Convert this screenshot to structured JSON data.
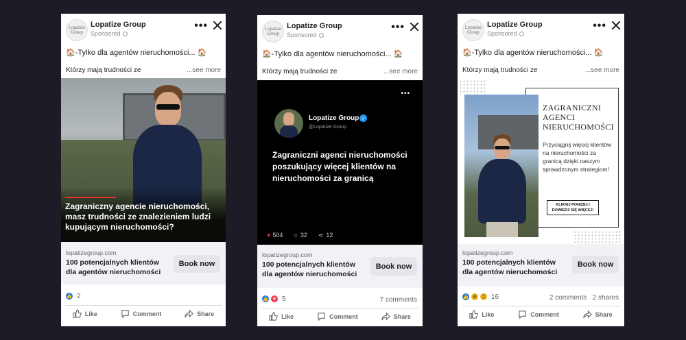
{
  "cards": [
    {
      "page_name": "Lopatize Group",
      "avatar_text": "Lopatize Group",
      "sponsored": "Sponsored",
      "headline": "-Tylko dla agentów nieruchomości...",
      "house_emoji": "🏠",
      "body_line": "Którzy mają trudności ze",
      "see_more": "...see more",
      "creative_text": "Zagraniczny agencie nieruchomości, masz trudności ze znalezieniem ludzi kupującym nieruchomości?",
      "site": "lopatizegroup.com",
      "offer": "100 potencjalnych klientów dla agentów nieruchomości",
      "cta": "Book now",
      "reaction_icons": [
        "like"
      ],
      "reaction_count": "2",
      "comments": "",
      "shares": "",
      "actions": {
        "like": "Like",
        "comment": "Comment",
        "share": "Share"
      }
    },
    {
      "page_name": "Lopatize Group",
      "avatar_text": "Lopatize Group",
      "sponsored": "Sponsored",
      "headline": "-Tylko dla agentów nieruchomości...",
      "house_emoji": "🏠",
      "body_line": "Którzy mają trudności ze",
      "see_more": "...see more",
      "tweet": {
        "name": "Lopatize Group",
        "handle": "@Lopatize Group",
        "text": "Zagraniczni agenci nieruchomości poszukujący więcej klientów na nieruchomości za granicą",
        "likes": "504",
        "comments": "32",
        "shares": "12"
      },
      "site": "lopatizegroup.com",
      "offer": "100 potencjalnych klientów dla agentów nieruchomości",
      "cta": "Book now",
      "reaction_icons": [
        "like",
        "love"
      ],
      "reaction_count": "5",
      "comments": "7 comments",
      "shares": "",
      "actions": {
        "like": "Like",
        "comment": "Comment",
        "share": "Share"
      }
    },
    {
      "page_name": "Lopatize Group",
      "avatar_text": "Lopatize Group",
      "sponsored": "Sponsored",
      "headline": "-Tylko dla agentów nieruchomości...",
      "house_emoji": "🏠",
      "body_line": "Którzy mają trudności ze",
      "see_more": "...see more",
      "poster": {
        "title": "ZAGRANICZNI AGENCI NIERUCHOMOŚCI",
        "text": "Przyciągnij więcej klientów na nieruchomości za granicą dzięki naszym sprawdzonym strategiom!",
        "button": "KLIKNIJ PONIŻEJ I DOWIEDZ SIĘ WIĘCEJ!"
      },
      "site": "lopatizegroup.com",
      "offer": "100 potencjalnych klientów dla agentów nieruchomości",
      "cta": "Book now",
      "reaction_icons": [
        "like",
        "haha",
        "wow"
      ],
      "reaction_count": "16",
      "comments": "2 comments",
      "shares": "2 shares",
      "actions": {
        "like": "Like",
        "comment": "Comment",
        "share": "Share"
      }
    }
  ],
  "colors": {
    "background": "#1c1b26",
    "facebook_blue": "#1b74e4",
    "cta_gray": "#e4e6eb",
    "accent_red": "#e4322b"
  }
}
